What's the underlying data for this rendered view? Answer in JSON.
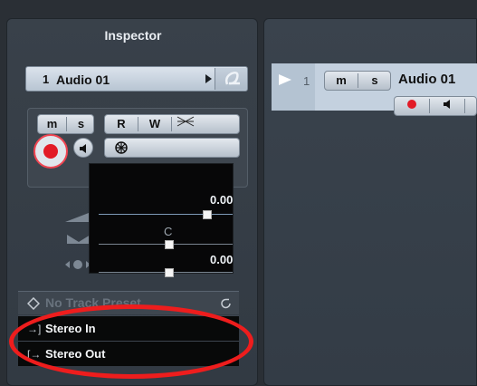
{
  "inspector": {
    "title": "Inspector",
    "track": {
      "number": "1",
      "name": "Audio 01"
    },
    "buttons": {
      "mute": "m",
      "solo": "s",
      "read": "R",
      "write": "W"
    },
    "fader": {
      "volume_value": "0.00",
      "pan_value": "C",
      "delay_value": "0.00"
    },
    "preset": {
      "label": "No Track Preset"
    },
    "routing": {
      "input": "Stereo In",
      "output": "Stereo Out"
    }
  },
  "project": {
    "track": {
      "number": "1",
      "name": "Audio 01",
      "mute": "m",
      "solo": "s"
    }
  },
  "colors": {
    "accent": "#ee1d1d",
    "record": "#e21b26",
    "panel": "#323a43"
  }
}
